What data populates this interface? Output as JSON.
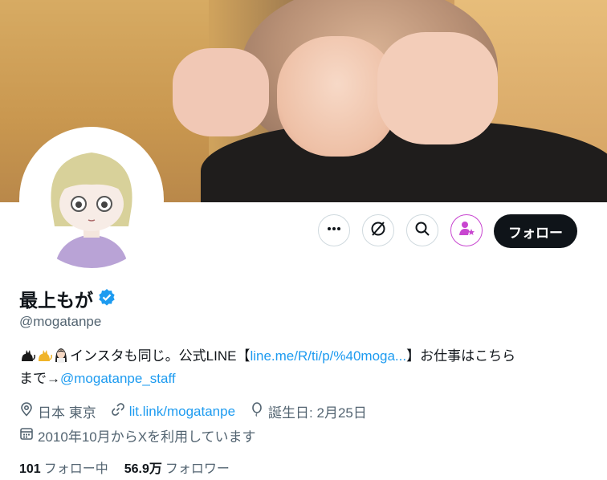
{
  "banner": {
    "alt": ""
  },
  "actions": {
    "more_icon": "more-horizontal-icon",
    "grok_icon": "grok-icon",
    "search_icon": "search-icon",
    "subscribe_icon": "subscribe-person-star-icon",
    "follow_label": "フォロー"
  },
  "profile": {
    "display_name": "最上もが",
    "verified": true,
    "handle": "@mogatanpe",
    "bio": {
      "text_before": "インスタも同じ。公式LINE【",
      "line_link": "line.me/R/ti/p/%40moga...",
      "text_after": "】お仕事はこちら",
      "line2_prefix": "まで→",
      "staff_link": "@mogatanpe_staff"
    },
    "location": "日本 東京",
    "website": "lit.link/mogatanpe",
    "birthday": "誕生日: 2月25日",
    "joined": "2010年10月からXを利用しています"
  },
  "stats": {
    "following_count": "101",
    "following_label": "フォロー中",
    "followers_count": "56.9万",
    "followers_label": "フォロワー"
  },
  "colors": {
    "accent": "#1d9bf0",
    "text": "#0f1419",
    "secondary": "#536471",
    "border": "#cfd9de",
    "subscribe": "#c846d0"
  }
}
